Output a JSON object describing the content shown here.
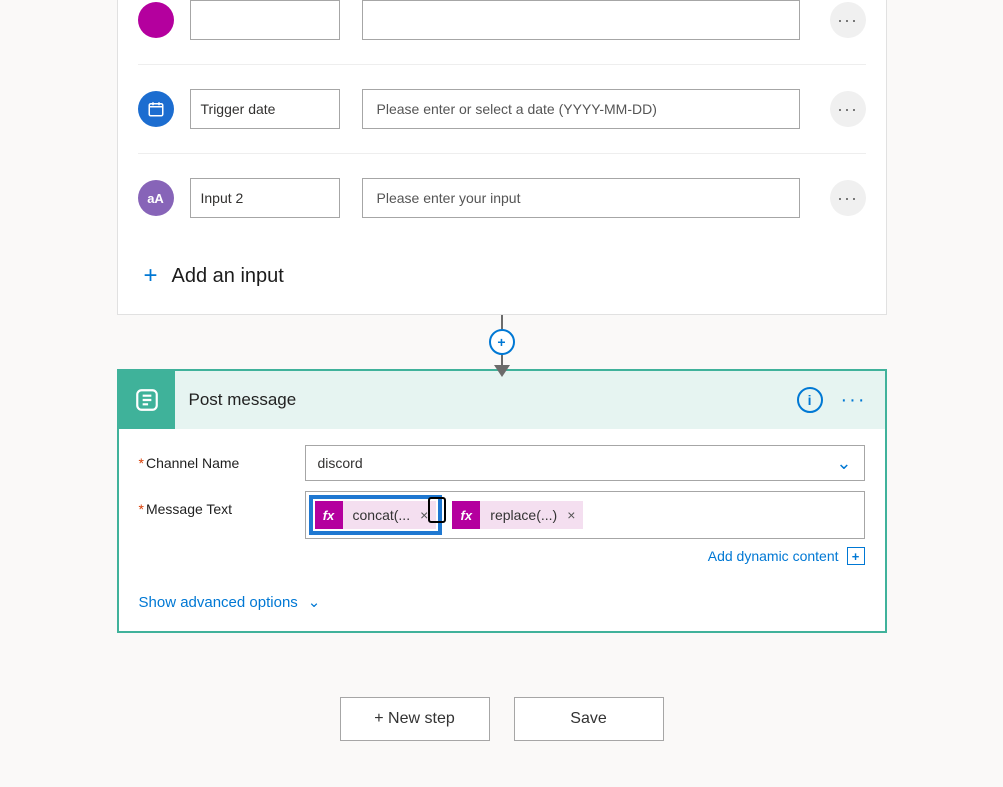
{
  "trigger": {
    "inputs": [
      {
        "name": "",
        "placeholder": ""
      },
      {
        "name": "Trigger date",
        "placeholder": "Please enter or select a date (YYYY-MM-DD)"
      },
      {
        "name": "Input 2",
        "placeholder": "Please enter your input"
      }
    ],
    "add_input_label": "Add an input"
  },
  "action": {
    "title": "Post message",
    "fields": [
      {
        "label": "Channel Name",
        "value": "discord"
      },
      {
        "label": "Message Text",
        "tokens": [
          {
            "type": "expression",
            "label": "concat(..."
          },
          {
            "type": "expression",
            "label": "replace(...)"
          }
        ]
      }
    ],
    "dynamic_content_label": "Add dynamic content",
    "advanced_label": "Show advanced options"
  },
  "buttons": {
    "new_step": "+ New step",
    "save": "Save"
  }
}
